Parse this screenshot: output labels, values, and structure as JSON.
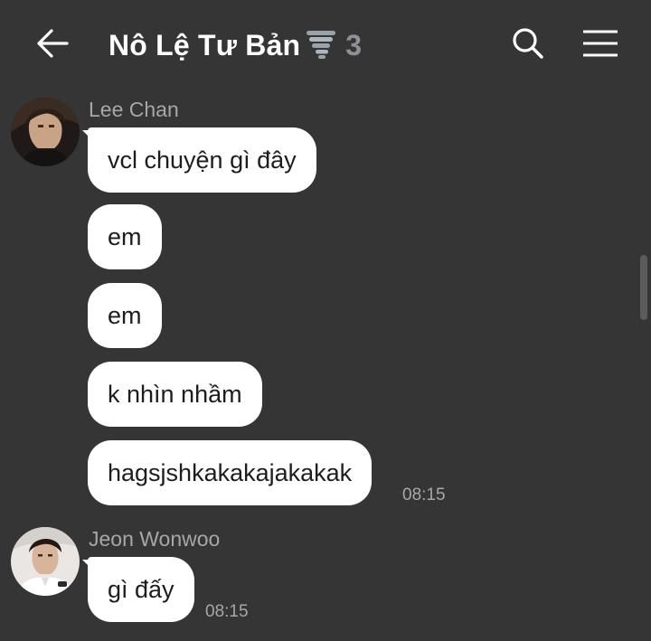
{
  "header": {
    "title": "Nô Lệ Tư Bản",
    "title_emoji": "tornado-icon",
    "member_count": "3",
    "back_icon": "arrow-left-icon",
    "search_icon": "search-icon",
    "menu_icon": "menu-icon"
  },
  "colors": {
    "background": "#343534",
    "bubble": "#ffffff",
    "bubble_text": "#1d1d1f",
    "muted_text": "#a6a7a8",
    "count": "#8f9195"
  },
  "messages": [
    {
      "sender": "Lee Chan",
      "bubbles": [
        "vcl chuyện gì đây",
        "em",
        "em",
        "k nhìn nhầm",
        "hagsjshkakakajakakak"
      ],
      "time": "08:15"
    },
    {
      "sender": "Jeon Wonwoo",
      "bubbles": [
        "gì đấy"
      ],
      "time": "08:15"
    }
  ]
}
